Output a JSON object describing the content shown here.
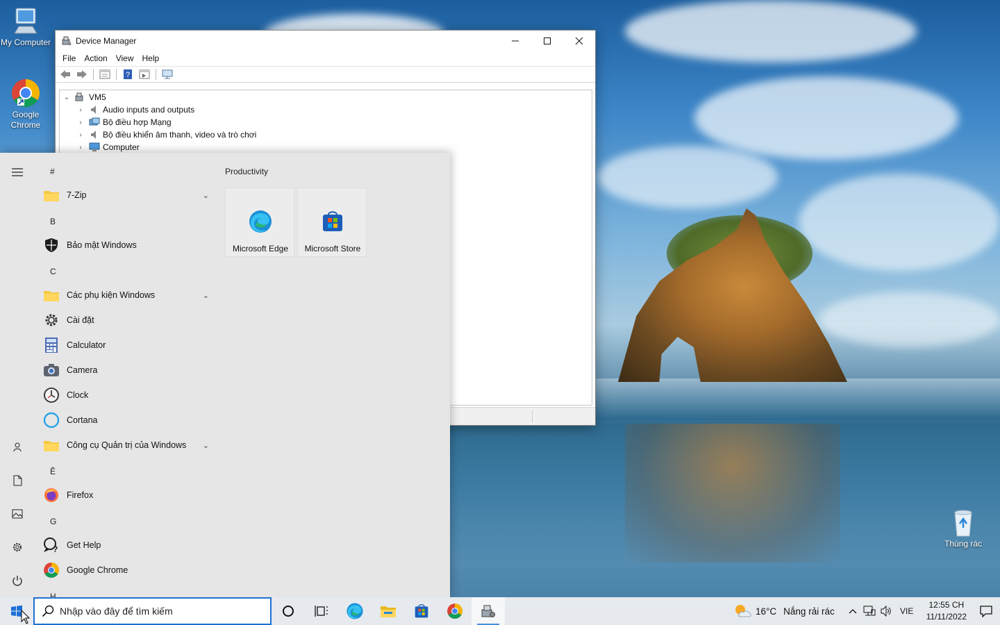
{
  "desktop": {
    "icons": [
      {
        "label": "My Computer",
        "icon": "monitor-icon"
      },
      {
        "label": "Google Chrome",
        "icon": "chrome-icon"
      },
      {
        "label": "Thùng rác",
        "icon": "recycle-bin-icon"
      }
    ]
  },
  "devmgr": {
    "title": "Device Manager",
    "menu": [
      "File",
      "Action",
      "View",
      "Help"
    ],
    "toolbar_icons": [
      "back-arrow-icon",
      "forward-arrow-icon",
      "properties-icon",
      "help-icon",
      "view-icon",
      "monitor-scan-icon"
    ],
    "tree": {
      "root": "VM5",
      "children": [
        "Audio inputs and outputs",
        "Bộ điều hợp Mạng",
        "Bộ điều khiển âm thanh, video và trò chơi",
        "Computer"
      ]
    }
  },
  "start": {
    "rail": [
      "hamburger-icon",
      "user-icon",
      "document-icon",
      "pictures-icon",
      "settings-icon",
      "power-icon"
    ],
    "letters": [
      "#",
      "B",
      "C",
      "Ê",
      "G",
      "H"
    ],
    "apps": [
      {
        "label": "7-Zip",
        "icon": "folder-icon",
        "expandable": true
      },
      {
        "label": "Bảo mật Windows",
        "icon": "shield-icon",
        "expandable": false
      },
      {
        "label": "Các phụ kiện Windows",
        "icon": "folder-icon",
        "expandable": true
      },
      {
        "label": "Cài đặt",
        "icon": "gear-icon",
        "expandable": false
      },
      {
        "label": "Calculator",
        "icon": "calculator-icon",
        "expandable": false
      },
      {
        "label": "Camera",
        "icon": "camera-icon",
        "expandable": false
      },
      {
        "label": "Clock",
        "icon": "clock-icon",
        "expandable": false
      },
      {
        "label": "Cortana",
        "icon": "cortana-icon",
        "expandable": false
      },
      {
        "label": "Công cụ Quản trị của Windows",
        "icon": "folder-icon",
        "expandable": true
      },
      {
        "label": "Firefox",
        "icon": "firefox-icon",
        "expandable": false
      },
      {
        "label": "Get Help",
        "icon": "help-icon",
        "expandable": false
      },
      {
        "label": "Google Chrome",
        "icon": "chrome-icon",
        "expandable": false
      }
    ],
    "tile_group": "Productivity",
    "tiles": [
      {
        "label": "Microsoft Edge",
        "icon": "edge-icon"
      },
      {
        "label": "Microsoft Store",
        "icon": "store-icon"
      }
    ]
  },
  "taskbar": {
    "search_placeholder": "Nhập vào đây để tìm kiếm",
    "pinned": [
      "cortana-circle-icon",
      "task-view-icon",
      "edge-icon",
      "file-explorer-icon",
      "store-icon",
      "chrome-icon",
      "device-manager-icon"
    ],
    "weather": {
      "temp": "16°C",
      "condition": "Nắng rải rác"
    },
    "language": "VIE",
    "time": "12:55 CH",
    "date": "11/11/2022"
  }
}
